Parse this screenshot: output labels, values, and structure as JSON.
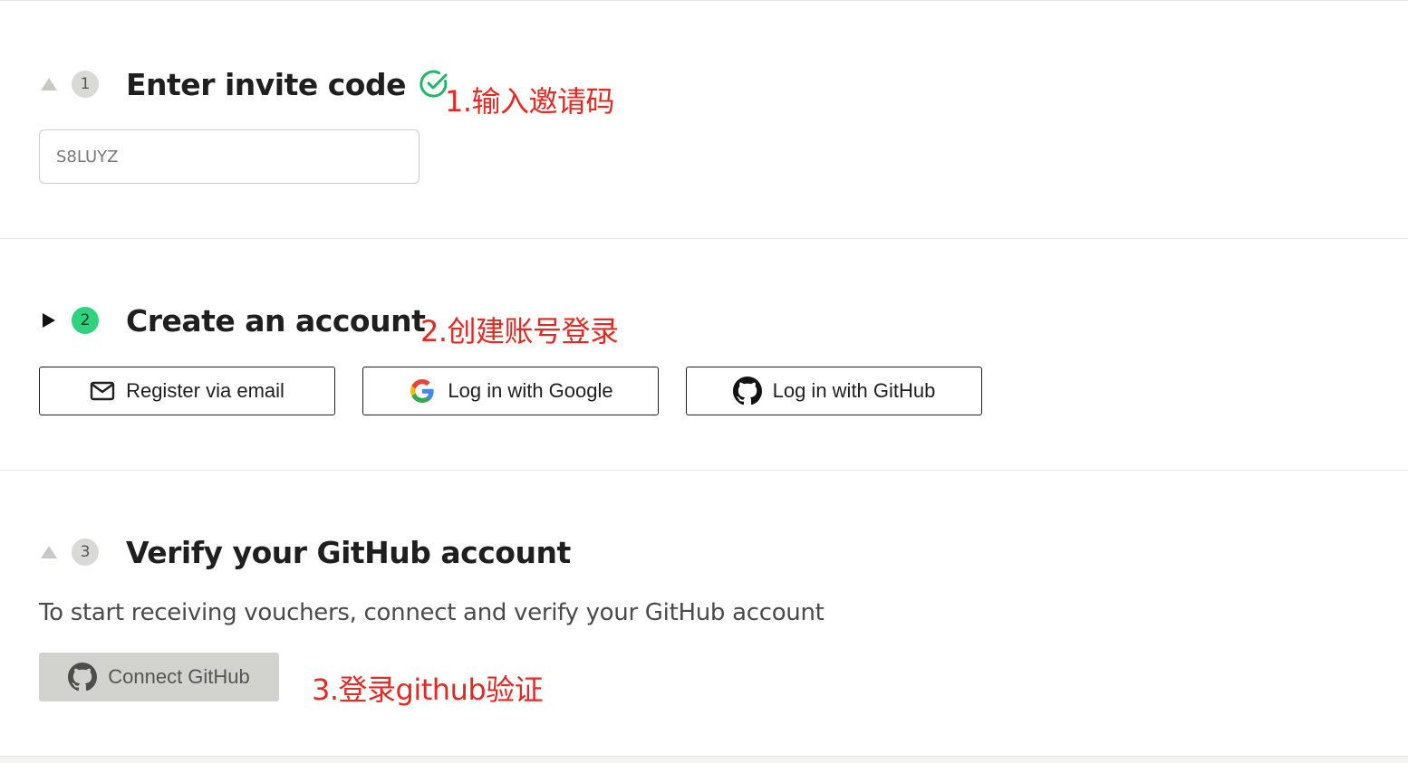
{
  "steps": [
    {
      "number": "1",
      "title": "Enter invite code",
      "completed": true,
      "toggle_icon": "triangle-up-icon",
      "annotation": "1.输入邀请码",
      "input": {
        "value": "S8LUYZ"
      }
    },
    {
      "number": "2",
      "title": "Create an account",
      "active": true,
      "toggle_icon": "triangle-right-icon",
      "annotation": "2.创建账号登录",
      "buttons": [
        {
          "label": "Register via email",
          "icon": "mail-icon"
        },
        {
          "label": "Log in with Google",
          "icon": "google-icon"
        },
        {
          "label": "Log in with GitHub",
          "icon": "github-icon"
        }
      ]
    },
    {
      "number": "3",
      "title": "Verify your GitHub account",
      "toggle_icon": "triangle-up-icon",
      "description": "To start receiving vouchers, connect and verify your GitHub account",
      "annotation": "3.登录github验证",
      "button": {
        "label": "Connect GitHub",
        "icon": "github-icon"
      }
    }
  ],
  "colors": {
    "active_step": "#2fd27f",
    "inactive_step": "#d9d9d6",
    "check_green": "#22b46b",
    "annotation_red": "#e22a22",
    "disabled_button": "#d2d2cf"
  }
}
